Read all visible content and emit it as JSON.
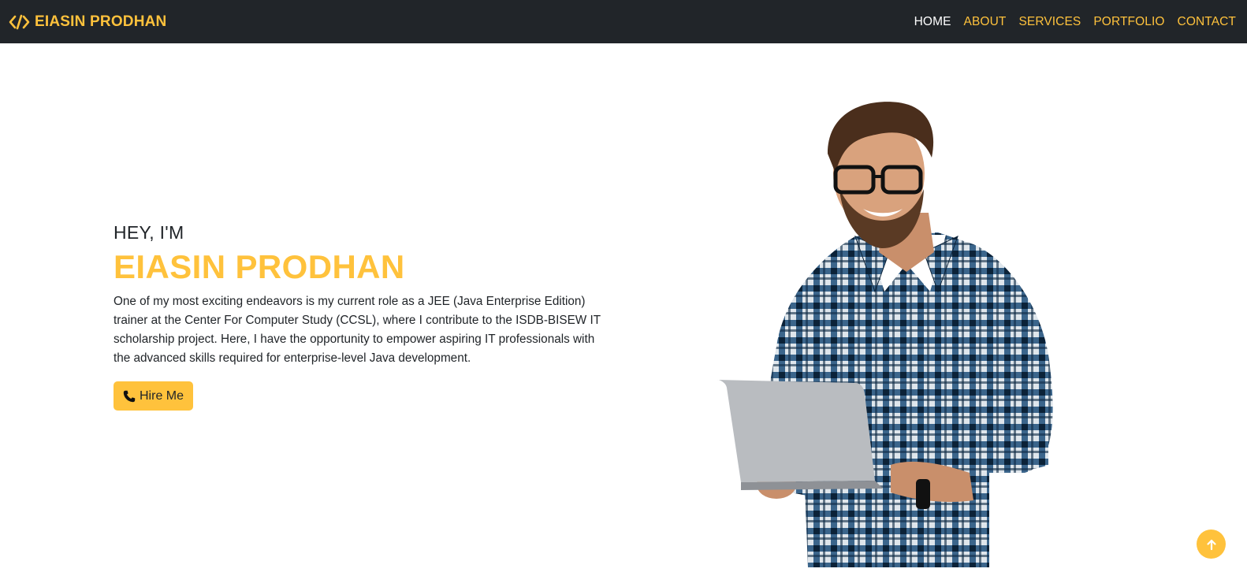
{
  "brand": {
    "name": "EIASIN PRODHAN",
    "icon": "code-icon"
  },
  "nav": {
    "items": [
      {
        "label": "HOME",
        "active": true
      },
      {
        "label": "ABOUT",
        "active": false
      },
      {
        "label": "SERVICES",
        "active": false
      },
      {
        "label": "PORTFOLIO",
        "active": false
      },
      {
        "label": "CONTACT",
        "active": false
      }
    ]
  },
  "hero": {
    "greeting": "HEY, I'M",
    "name": "EIASIN PRODHAN",
    "description": "One of my most exciting endeavors is my current role as a JEE (Java Enterprise Edition) trainer at the Center For Computer Study (CCSL), where I contribute to the ISDB-BISEW IT scholarship project. Here, I have the opportunity to empower aspiring IT professionals with the advanced skills required for enterprise-level Java development.",
    "button_label": "Hire Me",
    "button_icon": "phone-icon",
    "image": "man-with-laptop-photo"
  },
  "scroll_top": {
    "icon": "arrow-up-icon"
  },
  "colors": {
    "accent": "#ffc23c",
    "navbar_bg": "#212529",
    "text": "#212529",
    "nav_active": "#ffffff"
  }
}
